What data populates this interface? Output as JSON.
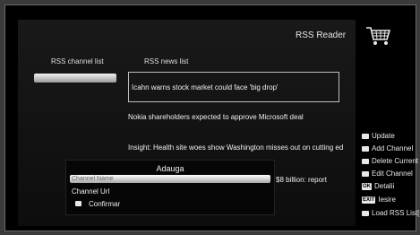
{
  "header": {
    "title": "RSS Reader",
    "cart_icon": "shopping-cart-icon"
  },
  "channel_list": {
    "header": "RSS channel list",
    "selected_item": ""
  },
  "news_list": {
    "header": "RSS news list",
    "items": [
      "Icahn warns stock market could face 'big drop'",
      "Nokia shareholders expected to approve Microsoft deal",
      "Insight: Health site woes show Washington misses out on cutting ed",
      "$8 billion: report"
    ]
  },
  "dialog": {
    "title": "Adauga",
    "field_label": "Channel Name",
    "url_label": "Channel Url",
    "confirm_label": "Confirmar"
  },
  "menu": [
    {
      "label": "Update",
      "icon": "square-button-icon"
    },
    {
      "label": "Add Channel",
      "icon": "square-button-icon"
    },
    {
      "label": "Delete Current",
      "icon": "square-button-icon"
    },
    {
      "label": "Edit Channel",
      "icon": "square-button-icon"
    },
    {
      "key": "OK",
      "label": "Detalii"
    },
    {
      "key": "EXIT",
      "label": "Iesire"
    },
    {
      "label": "Load RSS List[s",
      "icon": "square-button-icon"
    }
  ]
}
